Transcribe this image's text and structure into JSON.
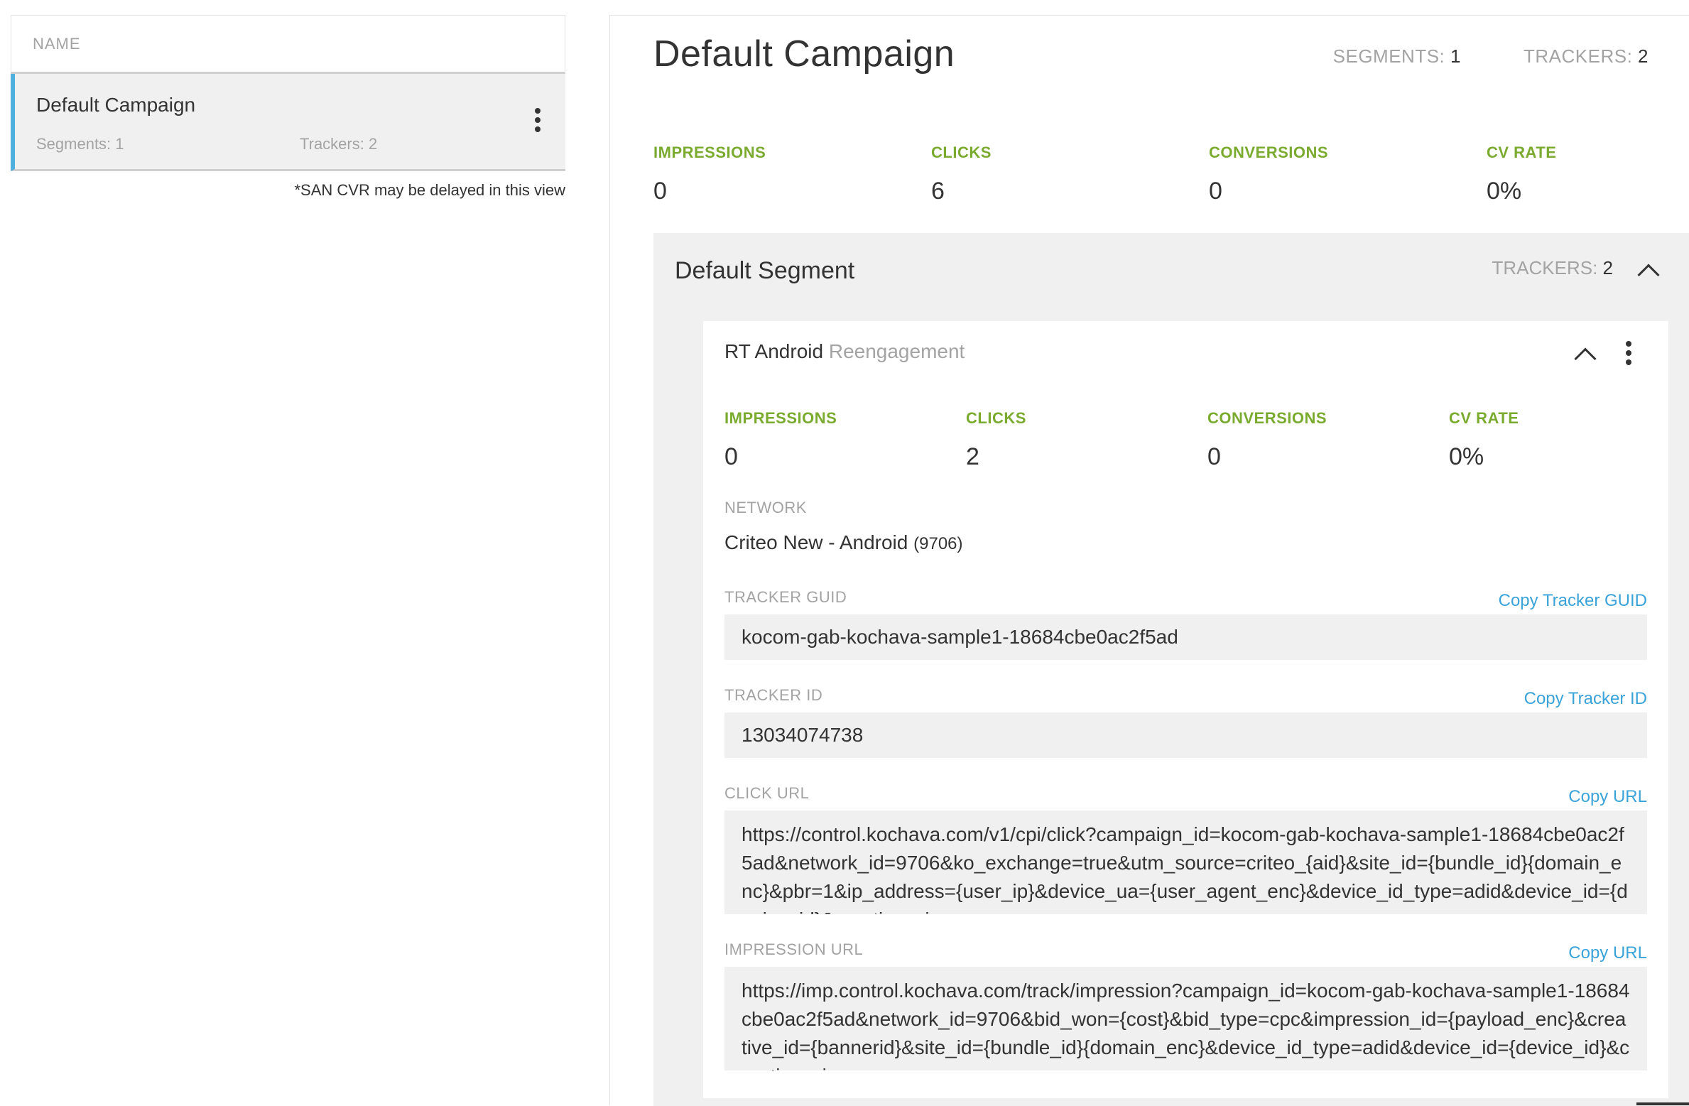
{
  "list": {
    "header": "NAME",
    "campaigns": [
      {
        "name": "Default Campaign",
        "segments": "Segments: 1",
        "trackers": "Trackers: 2"
      }
    ],
    "note": "*SAN CVR may be delayed in this view"
  },
  "campaign": {
    "title": "Default Campaign",
    "segments_label": "SEGMENTS:",
    "segments_value": "1",
    "trackers_label": "TRACKERS:",
    "trackers_value": "2",
    "stats": [
      {
        "label": "IMPRESSIONS",
        "value": "0"
      },
      {
        "label": "CLICKS",
        "value": "6"
      },
      {
        "label": "CONVERSIONS",
        "value": "0"
      },
      {
        "label": "CV RATE",
        "value": "0%"
      }
    ]
  },
  "segment": {
    "title": "Default Segment",
    "trackers_label": "TRACKERS:",
    "trackers_value": "2"
  },
  "tracker": {
    "name": "RT Android",
    "type": "Reengagement",
    "stats": [
      {
        "label": "IMPRESSIONS",
        "value": "0"
      },
      {
        "label": "CLICKS",
        "value": "2"
      },
      {
        "label": "CONVERSIONS",
        "value": "0"
      },
      {
        "label": "CV RATE",
        "value": "0%"
      }
    ],
    "network_label": "NETWORK",
    "network_name": "Criteo New - Android",
    "network_id": "(9706)",
    "guid_label": "TRACKER GUID",
    "guid_copy": "Copy Tracker GUID",
    "guid_value": "kocom-gab-kochava-sample1-18684cbe0ac2f5ad",
    "id_label": "TRACKER ID",
    "id_copy": "Copy Tracker ID",
    "id_value": "13034074738",
    "click_url_label": "CLICK URL",
    "click_url_copy": "Copy URL",
    "click_url_value": "https://control.kochava.com/v1/cpi/click?campaign_id=kocom-gab-kochava-sample1-18684cbe0ac2f5ad&network_id=9706&ko_exchange=true&utm_source=criteo_{aid}&site_id={bundle_id}{domain_enc}&pbr=1&ip_address={user_ip}&device_ua={user_agent_enc}&device_id_type=adid&device_id={device_id}&creative_size=",
    "impression_url_label": "IMPRESSION URL",
    "impression_url_copy": "Copy URL",
    "impression_url_value": "https://imp.control.kochava.com/track/impression?campaign_id=kocom-gab-kochava-sample1-18684cbe0ac2f5ad&network_id=9706&bid_won={cost}&bid_type=cpc&impression_id={payload_enc}&creative_id={bannerid}&site_id={bundle_id}{domain_enc}&device_id_type=adid&device_id={device_id}&creative_size="
  }
}
